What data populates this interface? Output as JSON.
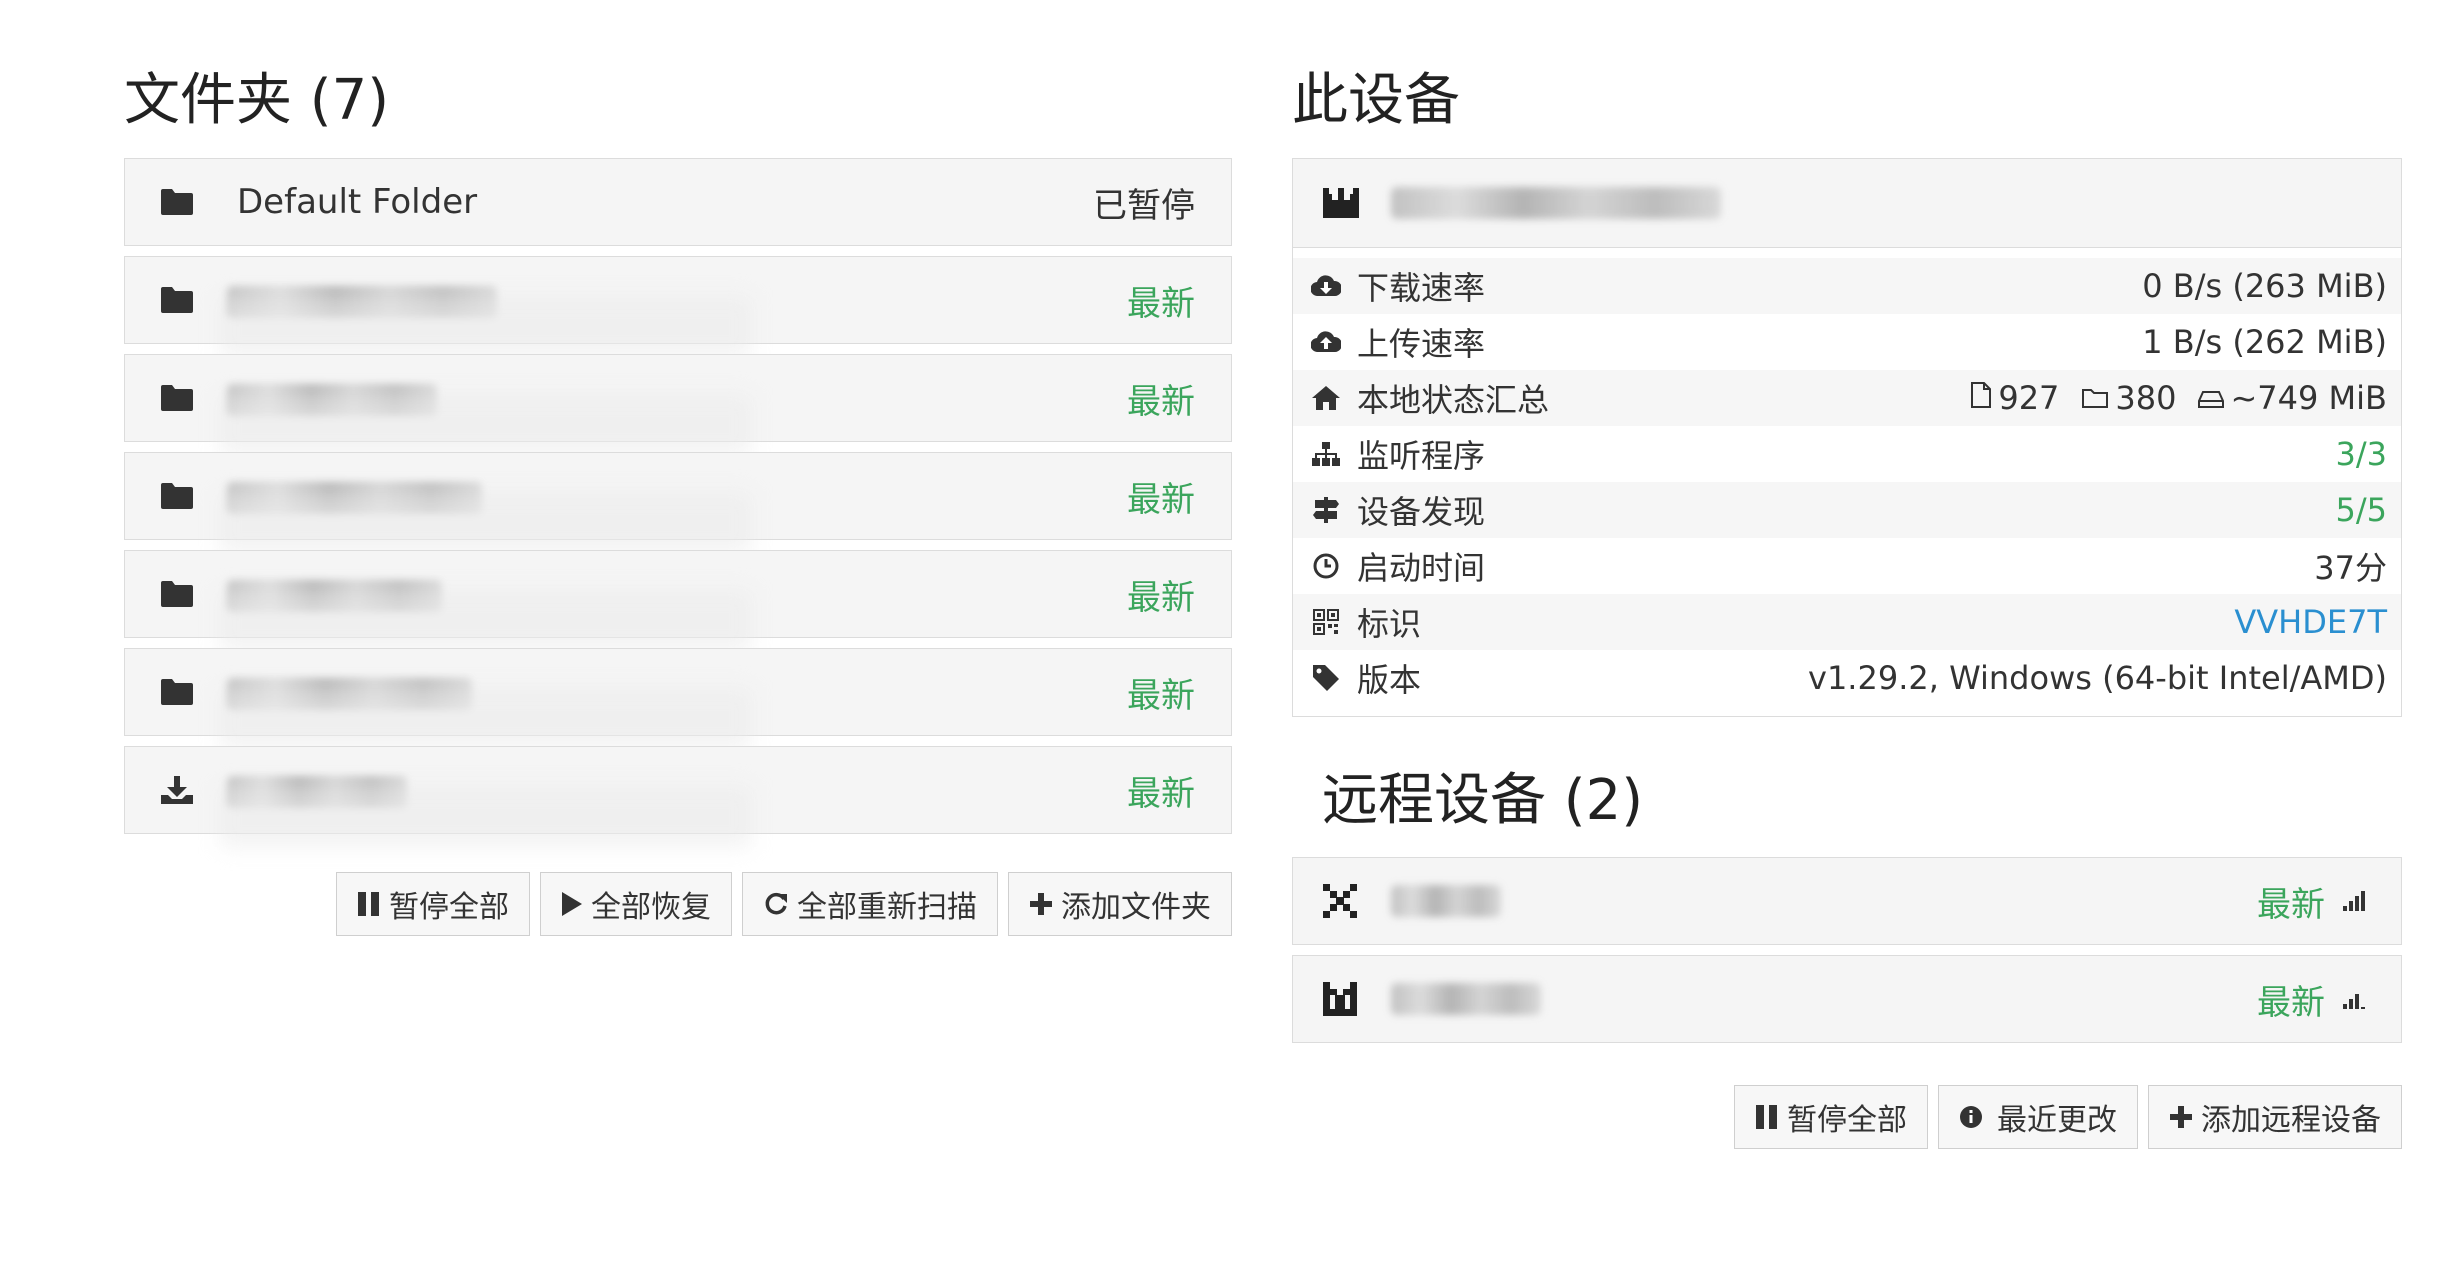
{
  "folders": {
    "title": "文件夹 (7)",
    "items": [
      {
        "name": "Default Folder",
        "status": "已暂停",
        "paused": true,
        "blurred": false,
        "icon": "folder-icon"
      },
      {
        "name": "",
        "status": "最新",
        "paused": false,
        "blurred": true,
        "icon": "folder-icon"
      },
      {
        "name": "",
        "status": "最新",
        "paused": false,
        "blurred": true,
        "icon": "folder-icon"
      },
      {
        "name": "",
        "status": "最新",
        "paused": false,
        "blurred": true,
        "icon": "folder-icon"
      },
      {
        "name": "",
        "status": "最新",
        "paused": false,
        "blurred": true,
        "icon": "folder-icon"
      },
      {
        "name": "",
        "status": "最新",
        "paused": false,
        "blurred": true,
        "icon": "folder-icon"
      },
      {
        "name": "",
        "status": "最新",
        "paused": false,
        "blurred": true,
        "icon": "download-icon"
      }
    ],
    "buttons": {
      "pause_all": "暂停全部",
      "resume_all": "全部恢复",
      "rescan_all": "全部重新扫描",
      "add_folder": "添加文件夹"
    }
  },
  "this_device": {
    "title": "此设备",
    "rows": {
      "download_label": "下载速率",
      "download_value": "0 B/s (263 MiB)",
      "upload_label": "上传速率",
      "upload_value": "1 B/s (262 MiB)",
      "local_state_label": "本地状态汇总",
      "local_files": "927",
      "local_dirs": "380",
      "local_size": "~749 MiB",
      "listeners_label": "监听程序",
      "listeners_value": "3/3",
      "discovery_label": "设备发现",
      "discovery_value": "5/5",
      "uptime_label": "启动时间",
      "uptime_value": "37分",
      "id_label": "标识",
      "id_value": "VVHDE7T",
      "version_label": "版本",
      "version_value": "v1.29.2, Windows (64-bit Intel/AMD)"
    }
  },
  "remote_devices": {
    "title": "远程设备 (2)",
    "items": [
      {
        "status": "最新",
        "signal_level": 4
      },
      {
        "status": "最新",
        "signal_level": 3
      }
    ],
    "buttons": {
      "pause_all": "暂停全部",
      "recent_changes": "最近更改",
      "add_device": "添加远程设备"
    }
  },
  "colors": {
    "up_to_date": "#3ba55c",
    "link": "#2a8fd0"
  }
}
